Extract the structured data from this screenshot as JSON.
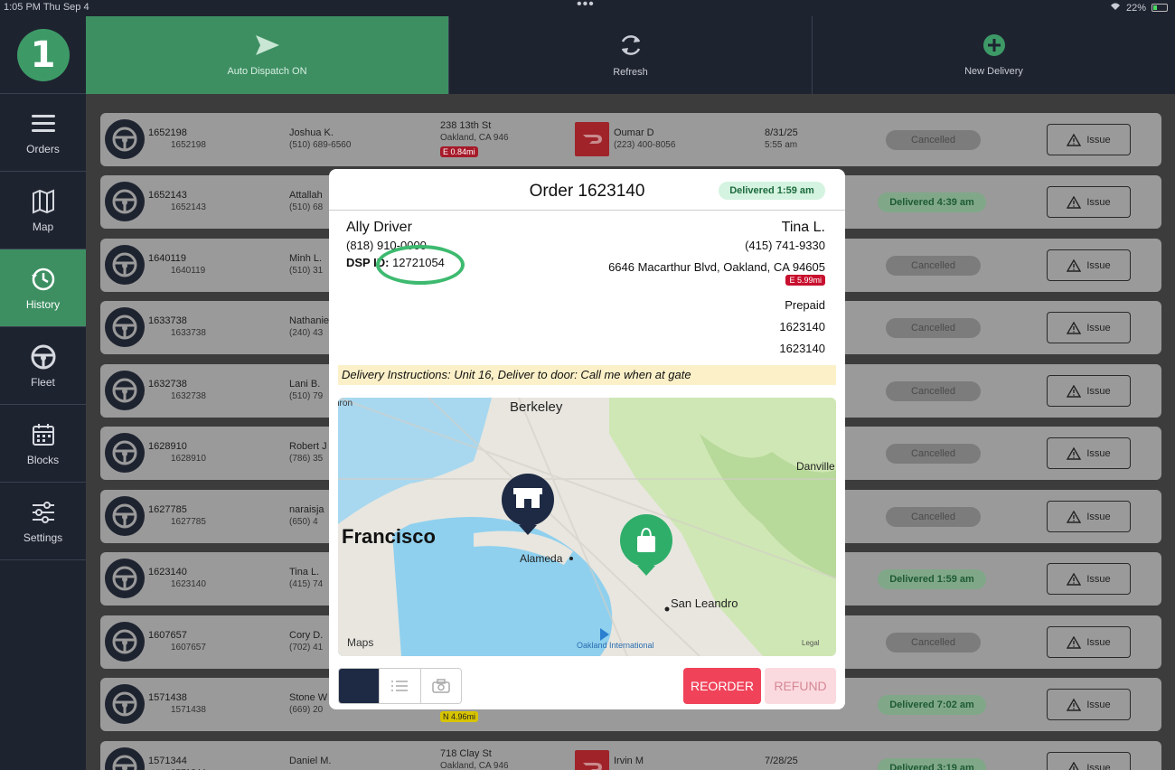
{
  "status_bar": {
    "time": "1:05 PM  Thu Sep 4",
    "battery": "22%"
  },
  "sidebar": {
    "logo": "1",
    "items": [
      {
        "label": "Orders",
        "icon": "hamburger-icon"
      },
      {
        "label": "Map",
        "icon": "map-icon"
      },
      {
        "label": "History",
        "icon": "history-icon"
      },
      {
        "label": "Fleet",
        "icon": "steering-wheel-icon"
      },
      {
        "label": "Blocks",
        "icon": "calendar-icon"
      },
      {
        "label": "Settings",
        "icon": "sliders-icon"
      }
    ]
  },
  "topbar": {
    "auto_dispatch": "Auto Dispatch ON",
    "refresh": "Refresh",
    "new_delivery": "New Delivery"
  },
  "rows": [
    {
      "id": "1652198",
      "id2": "1652198",
      "customer": "Joshua K.",
      "phone": "(510) 689-6560",
      "addr": "238 13th St",
      "addr2": "Oakland, CA 946",
      "dist": "E 0.84mi",
      "driver": "Oumar D",
      "dphone": "(223) 400-8056",
      "date": "8/31/25",
      "time": "5:55 am",
      "status": "Cancelled",
      "type": "cancel"
    },
    {
      "id": "1652143",
      "id2": "1652143",
      "customer": "Attallah",
      "phone": "(510) 68",
      "addr": "",
      "addr2": "",
      "dist": "",
      "driver": "",
      "dphone": "",
      "date": "",
      "time": "",
      "status": "Delivered 4:39 am",
      "type": "deliv"
    },
    {
      "id": "1640119",
      "id2": "1640119",
      "customer": "Minh L.",
      "phone": "(510) 31",
      "addr": "",
      "addr2": "",
      "dist": "",
      "driver": "",
      "dphone": "",
      "date": "",
      "time": "",
      "status": "Cancelled",
      "type": "cancel"
    },
    {
      "id": "1633738",
      "id2": "1633738",
      "customer": "Nathanie",
      "phone": "(240) 43",
      "addr": "",
      "addr2": "",
      "dist": "",
      "driver": "",
      "dphone": "",
      "date": "",
      "time": "",
      "status": "Cancelled",
      "type": "cancel"
    },
    {
      "id": "1632738",
      "id2": "1632738",
      "customer": "Lani B.",
      "phone": "(510) 79",
      "addr": "",
      "addr2": "",
      "dist": "",
      "driver": "",
      "dphone": "",
      "date": "",
      "time": "",
      "status": "Cancelled",
      "type": "cancel"
    },
    {
      "id": "1628910",
      "id2": "1628910",
      "customer": "Robert J",
      "phone": "(786) 35",
      "addr": "",
      "addr2": "",
      "dist": "",
      "driver": "",
      "dphone": "",
      "date": "",
      "time": "",
      "status": "Cancelled",
      "type": "cancel"
    },
    {
      "id": "1627785",
      "id2": "1627785",
      "customer": "naraisja",
      "phone": "(650) 4",
      "addr": "",
      "addr2": "",
      "dist": "",
      "driver": "",
      "dphone": "",
      "date": "",
      "time": "",
      "status": "Cancelled",
      "type": "cancel"
    },
    {
      "id": "1623140",
      "id2": "1623140",
      "customer": "Tina L.",
      "phone": "(415) 74",
      "addr": "",
      "addr2": "",
      "dist": "",
      "driver": "",
      "dphone": "",
      "date": "",
      "time": "",
      "status": "Delivered 1:59 am",
      "type": "deliv"
    },
    {
      "id": "1607657",
      "id2": "1607657",
      "customer": "Cory D.",
      "phone": "(702) 41",
      "addr": "",
      "addr2": "",
      "dist": "",
      "driver": "",
      "dphone": "",
      "date": "",
      "time": "",
      "status": "Cancelled",
      "type": "cancel"
    },
    {
      "id": "1571438",
      "id2": "1571438",
      "customer": "Stone W",
      "phone": "(669) 20",
      "addr": "",
      "addr2": "",
      "dist": "N 4.96mi",
      "driver": "",
      "dphone": "",
      "date": "",
      "time": "",
      "status": "Delivered 7:02 am",
      "type": "deliv"
    },
    {
      "id": "1571344",
      "id2": "1571344",
      "customer": "Daniel M.",
      "phone": "",
      "addr": "718 Clay St",
      "addr2": "Oakland, CA 946",
      "dist": "",
      "driver": "Irvin M",
      "dphone": "",
      "date": "7/28/25",
      "time": "",
      "status": "Delivered 3:19 am",
      "type": "deliv"
    }
  ],
  "issue_label": "Issue",
  "modal": {
    "title": "Order 1623140",
    "badge": "Delivered 1:59 am",
    "driver_name": "Ally Driver",
    "driver_phone": "(818) 910-0000",
    "dsp_label": "DSP ID:",
    "dsp_value": "12721054",
    "customer_name": "Tina L.",
    "customer_phone": "(415) 741-9330",
    "address": "6646 Macarthur Blvd, Oakland, CA 94605",
    "distance": "E 5.99mi",
    "payment": "Prepaid",
    "ref1": "1623140",
    "ref2": "1623140",
    "instructions": "Delivery Instructions: Unit 16, Deliver to door: Call me when at gate",
    "map_labels": {
      "berkeley": "Berkeley",
      "francisco": "Francisco",
      "alameda": "Alameda",
      "san_leandro": "San Leandro",
      "danville": "Danville",
      "oakland_intl": "Oakland International",
      "maps": "Maps",
      "legal": "Legal",
      "ron": "uron"
    },
    "reorder": "REORDER",
    "refund": "REFUND"
  },
  "colors": {
    "accent_green": "#3d8f62",
    "sidebar_bg": "#1e2330",
    "reorder": "#f0435a"
  }
}
